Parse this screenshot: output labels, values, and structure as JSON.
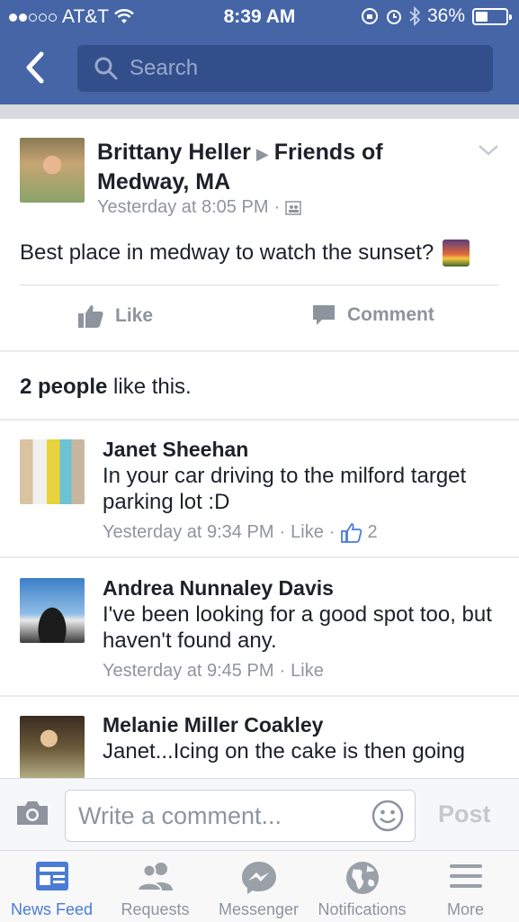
{
  "status_bar": {
    "carrier": "AT&T",
    "time": "8:39 AM",
    "battery": "36%",
    "battery_level": 0.36
  },
  "header": {
    "search_placeholder": "Search"
  },
  "post": {
    "author": "Brittany Heller",
    "group": "Friends of Medway, MA",
    "timestamp": "Yesterday at 8:05 PM",
    "separator": "·",
    "text": "Best place in medway to watch the sunset?",
    "like_label": "Like",
    "comment_label": "Comment",
    "likes_count": "2 people",
    "likes_suffix": "like this."
  },
  "comments": [
    {
      "name": "Janet Sheehan",
      "text": "In your car driving to the milford target parking lot :D",
      "time": "Yesterday at 9:34 PM",
      "like": "Like",
      "like_count": "2"
    },
    {
      "name": "Andrea Nunnaley Davis",
      "text": "I've been looking for a good spot too, but haven't found any.",
      "time": "Yesterday at 9:45 PM",
      "like": "Like"
    },
    {
      "name": "Melanie Miller Coakley",
      "text": "Janet...Icing on the cake is then going"
    }
  ],
  "composer": {
    "placeholder": "Write a comment...",
    "post_label": "Post"
  },
  "tabs": [
    {
      "label": "News Feed",
      "icon": "news-feed-icon",
      "active": true
    },
    {
      "label": "Requests",
      "icon": "friend-requests-icon"
    },
    {
      "label": "Messenger",
      "icon": "messenger-icon"
    },
    {
      "label": "Notifications",
      "icon": "globe-icon"
    },
    {
      "label": "More",
      "icon": "menu-icon"
    }
  ],
  "colors": {
    "header": "#4565a7",
    "search_bg": "#334f8b",
    "active_tab": "#4a7cd6",
    "muted": "#90949c"
  }
}
